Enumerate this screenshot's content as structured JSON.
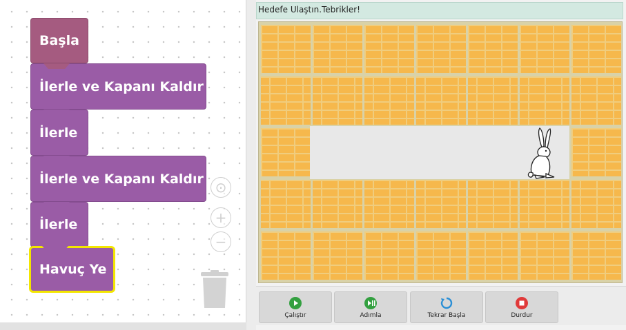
{
  "blocks": {
    "start": "Başla",
    "cmd1": "İlerle ve Kapanı Kaldır",
    "cmd2": "İlerle",
    "cmd3": "İlerle ve Kapanı Kaldır",
    "cmd4": "İlerle",
    "carrot": "Havuç Ye"
  },
  "workspace_controls": {
    "center": "⊙",
    "zoom_in": "+",
    "zoom_out": "−"
  },
  "status": "Hedefe Ulaştın.Tebrikler!",
  "toolbar": {
    "run": "Çalıştır",
    "step": "Adımla",
    "restart": "Tekrar Başla",
    "stop": "Durdur"
  },
  "icons": {
    "run": "play-circle-icon",
    "step": "step-icon",
    "restart": "restart-icon",
    "stop": "stop-icon",
    "trash": "trash-icon",
    "rabbit": "rabbit-icon"
  },
  "colors": {
    "start_block": "#a55b80",
    "command_block": "#9a5ca6",
    "selected_outline": "#f3e600",
    "brick": "#f6b84c",
    "status_bg": "#d3e9e1",
    "run_green": "#33a040",
    "restart_blue": "#2a8fd6",
    "stop_red": "#e03a3a"
  }
}
